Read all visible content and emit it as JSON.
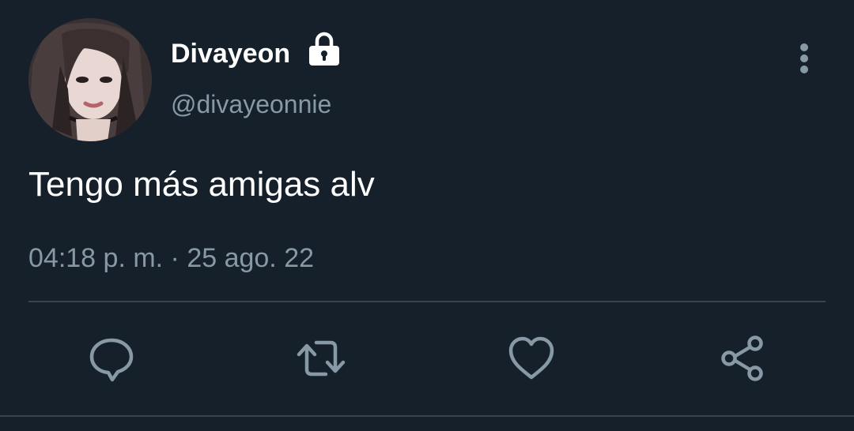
{
  "user": {
    "display_name": "Divayeon",
    "handle": "@divayeonnie",
    "protected_icon": "lock-icon",
    "avatar": "profile-photo"
  },
  "tweet": {
    "text": "Tengo más amigas alv",
    "timestamp": "04:18 p. m. · 25 ago. 22"
  },
  "actions": [
    {
      "name": "reply",
      "icon": "speech-bubble-icon"
    },
    {
      "name": "retweet",
      "icon": "retweet-arrows-icon"
    },
    {
      "name": "like",
      "icon": "heart-icon"
    },
    {
      "name": "share",
      "icon": "share-icon"
    }
  ],
  "menu": {
    "icon": "vertical-ellipsis-icon"
  },
  "colors": {
    "background": "#15202b",
    "text_primary": "#ffffff",
    "text_secondary": "#8899a6",
    "divider": "#38444d",
    "icon": "#8899a6"
  }
}
